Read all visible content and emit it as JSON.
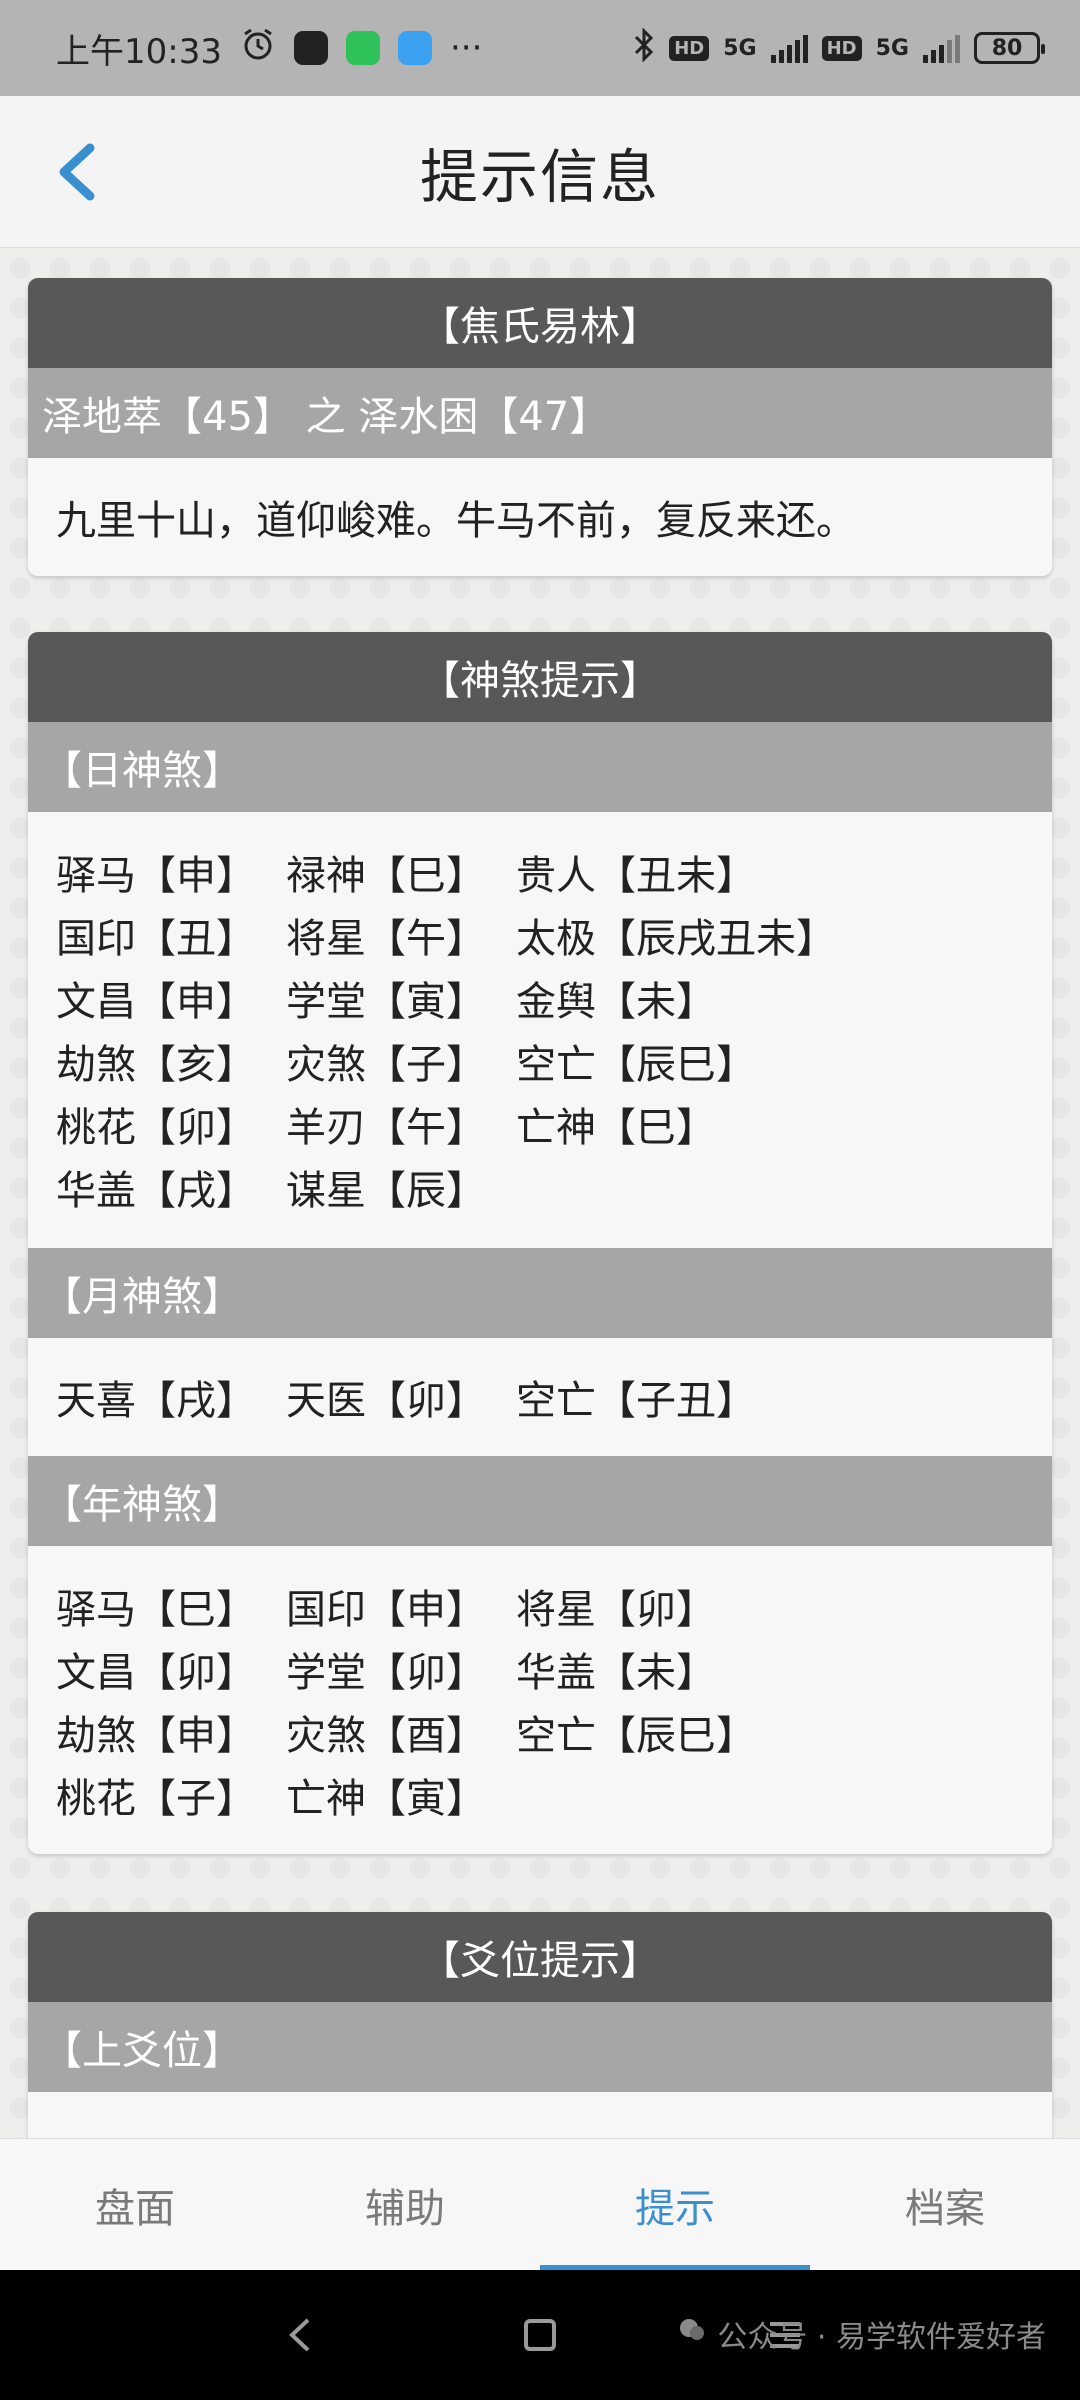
{
  "status_bar": {
    "time": "上午10:33",
    "more": "···",
    "net1": "5G",
    "net2": "5G",
    "hd": "HD",
    "battery": "80"
  },
  "header": {
    "title": "提示信息"
  },
  "card_jiaoshi": {
    "title": "【焦氏易林】",
    "subtitle": "泽地萃【45】 之 泽水困【47】",
    "text": "九里十山，道仰峻难。牛马不前，复反来还。"
  },
  "card_shensha": {
    "title": "【神煞提示】",
    "day": {
      "label": "【日神煞】",
      "rows": [
        [
          "驿马【申】",
          "禄神【巳】",
          "贵人【丑未】"
        ],
        [
          "国印【丑】",
          "将星【午】",
          "太极【辰戌丑未】"
        ],
        [
          "文昌【申】",
          "学堂【寅】",
          "金舆【未】"
        ],
        [
          "劫煞【亥】",
          "灾煞【子】",
          "空亡【辰巳】"
        ],
        [
          "桃花【卯】",
          "羊刃【午】",
          "亡神【巳】"
        ],
        [
          "华盖【戌】",
          "谋星【辰】",
          ""
        ]
      ]
    },
    "month": {
      "label": "【月神煞】",
      "rows": [
        [
          "天喜【戌】",
          "天医【卯】",
          "空亡【子丑】"
        ]
      ]
    },
    "year": {
      "label": "【年神煞】",
      "rows": [
        [
          "驿马【巳】",
          "国印【申】",
          "将星【卯】"
        ],
        [
          "文昌【卯】",
          "学堂【卯】",
          "华盖【未】"
        ],
        [
          "劫煞【申】",
          "灾煞【酉】",
          "空亡【辰巳】"
        ],
        [
          "桃花【子】",
          "亡神【寅】",
          ""
        ]
      ]
    }
  },
  "card_yaowei": {
    "title": "【爻位提示】",
    "subtitle": "【上爻位】"
  },
  "bottom_nav": {
    "tabs": [
      {
        "label": "盘面"
      },
      {
        "label": "辅助"
      },
      {
        "label": "提示"
      },
      {
        "label": "档案"
      }
    ],
    "active_index": 2
  },
  "watermark": {
    "text": "公众号 · 易学软件爱好者"
  },
  "colors": {
    "accent": "#3a8fcf",
    "card_header_bg": "#585858",
    "sub_header_bg": "#a6a6a6"
  }
}
